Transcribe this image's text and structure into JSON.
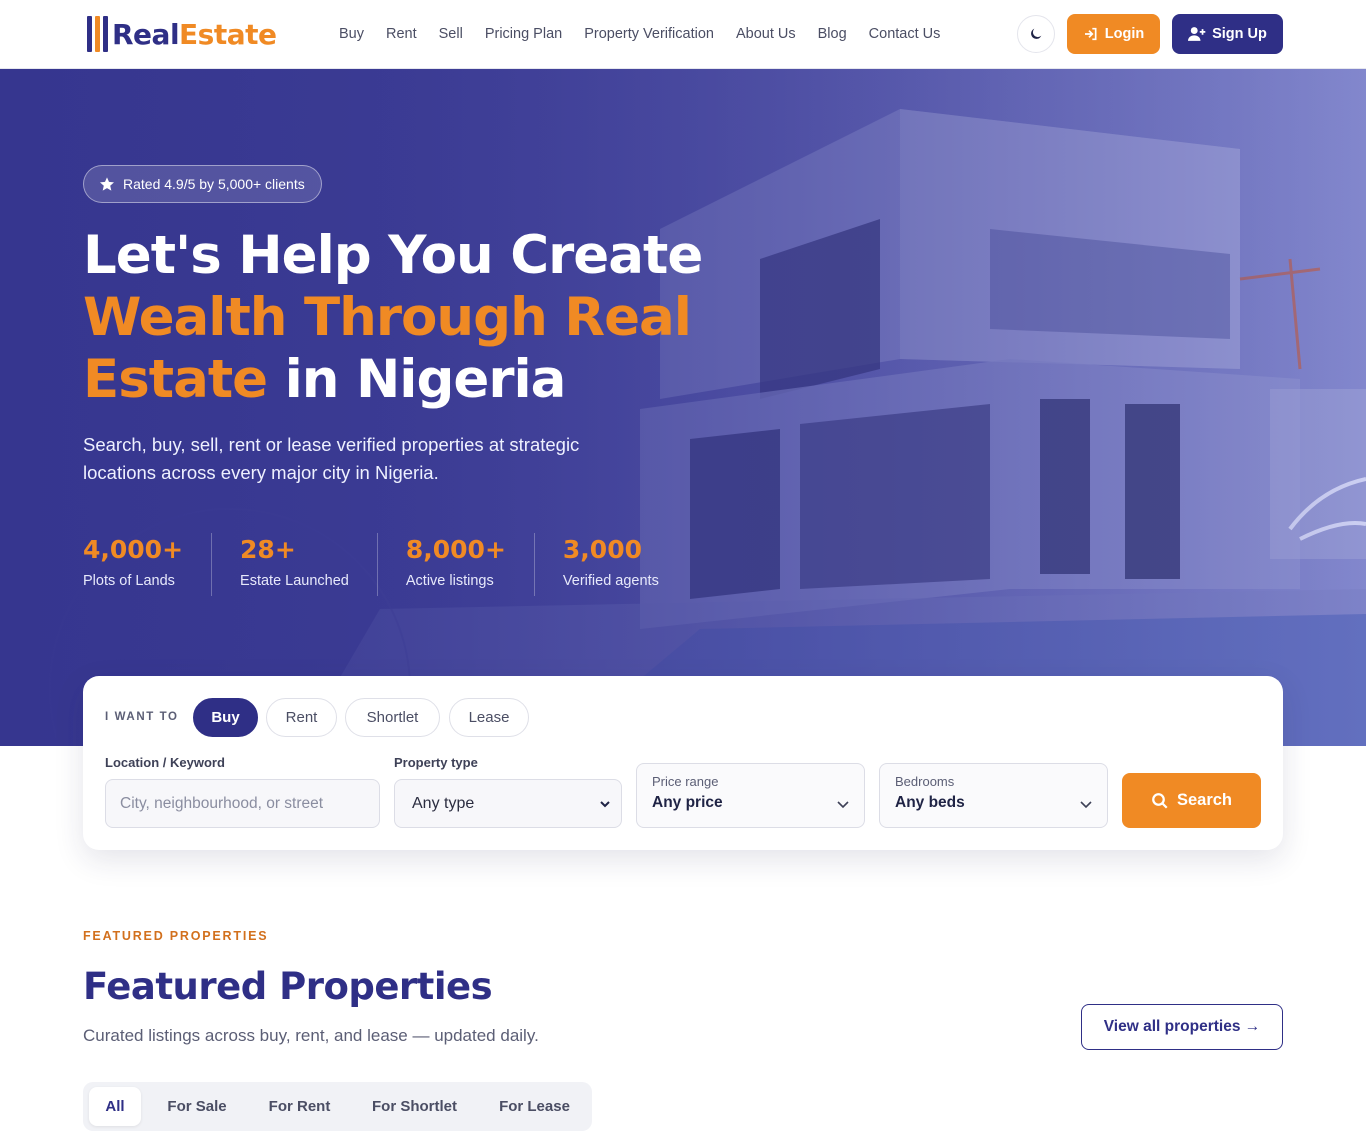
{
  "brand": {
    "name_part1": "Real",
    "name_part2": "Estate"
  },
  "nav": {
    "links": [
      "Buy",
      "Rent",
      "Sell",
      "Pricing Plan",
      "Property Verification",
      "About Us",
      "Blog",
      "Contact Us"
    ],
    "login_label": "Login",
    "signup_label": "Sign Up",
    "theme_icon": "moon-icon"
  },
  "hero": {
    "rating_text": "Rated 4.9/5 by 5,000+ clients",
    "headline_line1": "Let's Help You Create",
    "headline_orange": "Wealth Through Real Estate",
    "headline_end": "in Nigeria",
    "subtitle": "Search, buy, sell, rent or lease verified properties at strategic locations across every major city in Nigeria.",
    "stats": [
      {
        "value": "4,000+",
        "label": "Plots of Lands"
      },
      {
        "value": "28+",
        "label": "Estate Launched"
      },
      {
        "value": "8,000+",
        "label": "Active listings"
      },
      {
        "value": "3,000",
        "label": "Verified agents"
      }
    ]
  },
  "search": {
    "want_label": "I WANT TO",
    "modes": [
      "Buy",
      "Rent",
      "Shortlet",
      "Lease"
    ],
    "active_mode": "Buy",
    "location_label": "Location / Keyword",
    "location_placeholder": "City, neighbourhood, or street",
    "type_label": "Property type",
    "type_value": "Any type",
    "price_label": "Price range",
    "price_value": "Any price",
    "bedrooms_label": "Bedrooms",
    "bedrooms_value": "Any beds",
    "button_label": "Search"
  },
  "featured": {
    "eyebrow": "FEATURED PROPERTIES",
    "title": "Featured Properties",
    "subtitle": "Curated listings across buy, rent, and lease — updated daily.",
    "view_all": "View all properties →",
    "tabs": [
      "All",
      "For Sale",
      "For Rent",
      "For Shortlet",
      "For Lease"
    ],
    "active_tab": "All"
  },
  "colors": {
    "primary": "#2f2f86",
    "accent": "#f08a24"
  }
}
